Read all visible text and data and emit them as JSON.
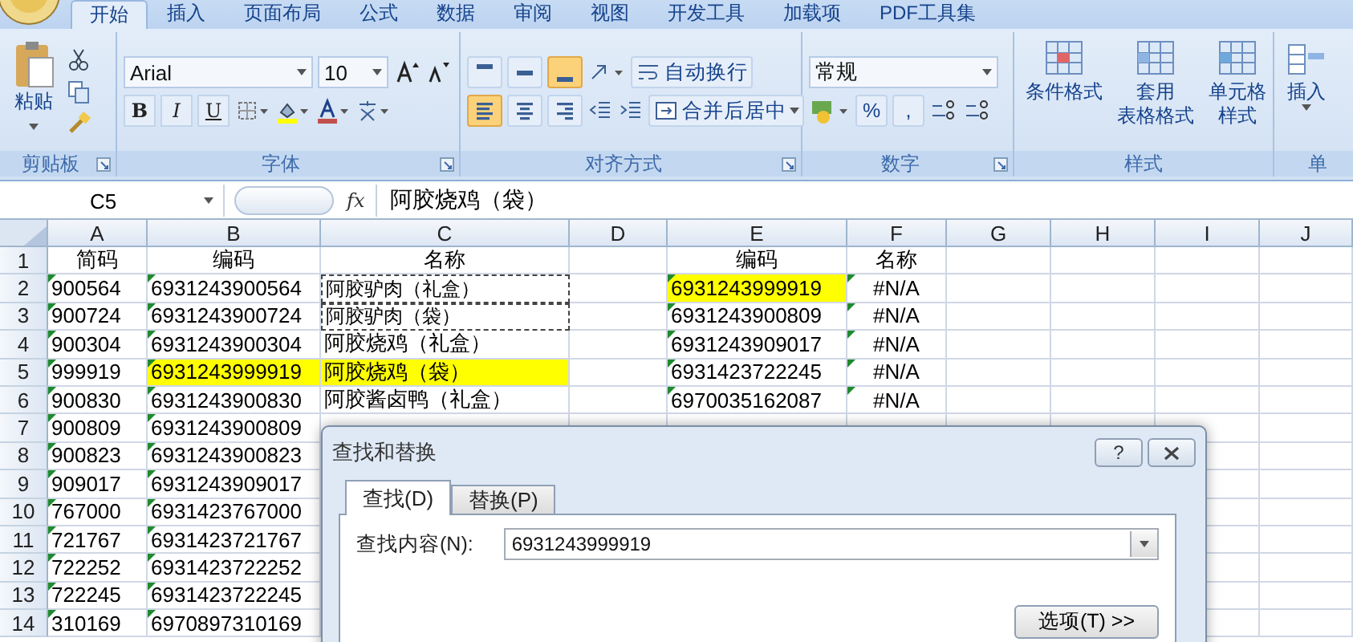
{
  "tabs": [
    {
      "label": "开始",
      "selected": true
    },
    {
      "label": "插入",
      "selected": false
    },
    {
      "label": "页面布局",
      "selected": false
    },
    {
      "label": "公式",
      "selected": false
    },
    {
      "label": "数据",
      "selected": false
    },
    {
      "label": "审阅",
      "selected": false
    },
    {
      "label": "视图",
      "selected": false
    },
    {
      "label": "开发工具",
      "selected": false
    },
    {
      "label": "加载项",
      "selected": false
    },
    {
      "label": "PDF工具集",
      "selected": false
    }
  ],
  "ribbon": {
    "clipboard": {
      "label": "剪贴板",
      "paste": "粘贴"
    },
    "font": {
      "label": "字体",
      "font_name": "Arial",
      "font_size": "10",
      "format_keys": [
        "B",
        "I",
        "U"
      ]
    },
    "alignment": {
      "label": "对齐方式",
      "vertical_buttons": [
        {
          "selected": false
        },
        {
          "selected": false
        },
        {
          "selected": true
        }
      ],
      "horizontal_buttons": [
        {
          "selected": true
        },
        {
          "selected": false
        },
        {
          "selected": false
        }
      ],
      "wrap": "自动换行",
      "merge": "合并后居中"
    },
    "number": {
      "label": "数字",
      "format": "常规",
      "percent": "%",
      "comma": ","
    },
    "styles": {
      "label": "样式",
      "buttons": [
        {
          "lines": [
            "条件格式"
          ]
        },
        {
          "lines": [
            "套用",
            "表格格式"
          ]
        },
        {
          "lines": [
            "单元格",
            "样式"
          ]
        }
      ]
    },
    "cells": {
      "label": "单",
      "insert": "插入"
    }
  },
  "formula_bar": {
    "name_box": "C5",
    "function_label": "fx",
    "content": "阿胶烧鸡（袋）"
  },
  "sheet": {
    "columns": [
      "A",
      "B",
      "C",
      "D",
      "E",
      "F",
      "G",
      "H",
      "I",
      "J"
    ],
    "rows": [
      {
        "number": "1",
        "cells": [
          {
            "text": "简码",
            "kind": "header",
            "flagged": false,
            "highlighted": false,
            "marquee": false
          },
          {
            "text": "编码",
            "kind": "header",
            "flagged": false,
            "highlighted": false,
            "marquee": false
          },
          {
            "text": "名称",
            "kind": "header",
            "flagged": false,
            "highlighted": false,
            "marquee": false
          },
          null,
          {
            "text": "编码",
            "kind": "header",
            "flagged": false,
            "highlighted": false,
            "marquee": false
          },
          {
            "text": "名称",
            "kind": "header",
            "flagged": false,
            "highlighted": false,
            "marquee": false
          },
          null,
          null,
          null,
          null
        ]
      },
      {
        "number": "2",
        "cells": [
          {
            "text": "900564",
            "kind": "text",
            "flagged": true,
            "highlighted": false,
            "marquee": false
          },
          {
            "text": "6931243900564",
            "kind": "text",
            "flagged": true,
            "highlighted": false,
            "marquee": false
          },
          {
            "text": "阿胶驴肉（礼盒）",
            "kind": "text",
            "flagged": false,
            "highlighted": false,
            "marquee": true
          },
          null,
          {
            "text": "6931243999919",
            "kind": "text",
            "flagged": true,
            "highlighted": true,
            "marquee": false
          },
          {
            "text": "#N/A",
            "kind": "error",
            "flagged": true,
            "highlighted": false,
            "marquee": false
          },
          null,
          null,
          null,
          null
        ]
      },
      {
        "number": "3",
        "cells": [
          {
            "text": "900724",
            "kind": "text",
            "flagged": true,
            "highlighted": false,
            "marquee": false
          },
          {
            "text": "6931243900724",
            "kind": "text",
            "flagged": true,
            "highlighted": false,
            "marquee": false
          },
          {
            "text": "阿胶驴肉（袋）",
            "kind": "text",
            "flagged": false,
            "highlighted": false,
            "marquee": true
          },
          null,
          {
            "text": "6931243900809",
            "kind": "text",
            "flagged": true,
            "highlighted": false,
            "marquee": false
          },
          {
            "text": "#N/A",
            "kind": "error",
            "flagged": true,
            "highlighted": false,
            "marquee": false
          },
          null,
          null,
          null,
          null
        ]
      },
      {
        "number": "4",
        "cells": [
          {
            "text": "900304",
            "kind": "text",
            "flagged": true,
            "highlighted": false,
            "marquee": false
          },
          {
            "text": "6931243900304",
            "kind": "text",
            "flagged": true,
            "highlighted": false,
            "marquee": false
          },
          {
            "text": "阿胶烧鸡（礼盒）",
            "kind": "text",
            "flagged": false,
            "highlighted": false,
            "marquee": false
          },
          null,
          {
            "text": "6931243909017",
            "kind": "text",
            "flagged": true,
            "highlighted": false,
            "marquee": false
          },
          {
            "text": "#N/A",
            "kind": "error",
            "flagged": true,
            "highlighted": false,
            "marquee": false
          },
          null,
          null,
          null,
          null
        ]
      },
      {
        "number": "5",
        "cells": [
          {
            "text": "999919",
            "kind": "text",
            "flagged": true,
            "highlighted": false,
            "marquee": false
          },
          {
            "text": "6931243999919",
            "kind": "text",
            "flagged": true,
            "highlighted": true,
            "marquee": false
          },
          {
            "text": "阿胶烧鸡（袋）",
            "kind": "text",
            "flagged": false,
            "highlighted": true,
            "marquee": false
          },
          null,
          {
            "text": "6931423722245",
            "kind": "text",
            "flagged": true,
            "highlighted": false,
            "marquee": false
          },
          {
            "text": "#N/A",
            "kind": "error",
            "flagged": true,
            "highlighted": false,
            "marquee": false
          },
          null,
          null,
          null,
          null
        ]
      },
      {
        "number": "6",
        "cells": [
          {
            "text": "900830",
            "kind": "text",
            "flagged": true,
            "highlighted": false,
            "marquee": false
          },
          {
            "text": "6931243900830",
            "kind": "text",
            "flagged": true,
            "highlighted": false,
            "marquee": false
          },
          {
            "text": "阿胶酱卤鸭（礼盒）",
            "kind": "text",
            "flagged": false,
            "highlighted": false,
            "marquee": false
          },
          null,
          {
            "text": "6970035162087",
            "kind": "text",
            "flagged": true,
            "highlighted": false,
            "marquee": false
          },
          {
            "text": "#N/A",
            "kind": "error",
            "flagged": true,
            "highlighted": false,
            "marquee": false
          },
          null,
          null,
          null,
          null
        ]
      },
      {
        "number": "7",
        "cells": [
          {
            "text": "900809",
            "kind": "text",
            "flagged": true,
            "highlighted": false,
            "marquee": false
          },
          {
            "text": "6931243900809",
            "kind": "text",
            "flagged": true,
            "highlighted": false,
            "marquee": false
          },
          null,
          null,
          null,
          null,
          null,
          null,
          null,
          null
        ]
      },
      {
        "number": "8",
        "cells": [
          {
            "text": "900823",
            "kind": "text",
            "flagged": true,
            "highlighted": false,
            "marquee": false
          },
          {
            "text": "6931243900823",
            "kind": "text",
            "flagged": true,
            "highlighted": false,
            "marquee": false
          },
          null,
          null,
          null,
          null,
          null,
          null,
          null,
          null
        ]
      },
      {
        "number": "9",
        "cells": [
          {
            "text": "909017",
            "kind": "text",
            "flagged": true,
            "highlighted": false,
            "marquee": false
          },
          {
            "text": "6931243909017",
            "kind": "text",
            "flagged": true,
            "highlighted": false,
            "marquee": false
          },
          null,
          null,
          null,
          null,
          null,
          null,
          null,
          null
        ]
      },
      {
        "number": "10",
        "cells": [
          {
            "text": "767000",
            "kind": "text",
            "flagged": true,
            "highlighted": false,
            "marquee": false
          },
          {
            "text": "6931423767000",
            "kind": "text",
            "flagged": true,
            "highlighted": false,
            "marquee": false
          },
          null,
          null,
          null,
          null,
          null,
          null,
          null,
          null
        ]
      },
      {
        "number": "11",
        "cells": [
          {
            "text": "721767",
            "kind": "text",
            "flagged": true,
            "highlighted": false,
            "marquee": false
          },
          {
            "text": "6931423721767",
            "kind": "text",
            "flagged": true,
            "highlighted": false,
            "marquee": false
          },
          null,
          null,
          null,
          null,
          null,
          null,
          null,
          null
        ]
      },
      {
        "number": "12",
        "cells": [
          {
            "text": "722252",
            "kind": "text",
            "flagged": true,
            "highlighted": false,
            "marquee": false
          },
          {
            "text": "6931423722252",
            "kind": "text",
            "flagged": true,
            "highlighted": false,
            "marquee": false
          },
          null,
          null,
          null,
          null,
          null,
          null,
          null,
          null
        ]
      },
      {
        "number": "13",
        "cells": [
          {
            "text": "722245",
            "kind": "text",
            "flagged": true,
            "highlighted": false,
            "marquee": false
          },
          {
            "text": "6931423722245",
            "kind": "text",
            "flagged": true,
            "highlighted": false,
            "marquee": false
          },
          null,
          null,
          null,
          null,
          null,
          null,
          null,
          null
        ]
      },
      {
        "number": "14",
        "cells": [
          {
            "text": "310169",
            "kind": "text",
            "flagged": true,
            "highlighted": false,
            "marquee": false
          },
          {
            "text": "6970897310169",
            "kind": "text",
            "flagged": true,
            "highlighted": false,
            "marquee": false
          },
          null,
          null,
          null,
          null,
          null,
          null,
          null,
          null
        ]
      }
    ]
  },
  "dialog": {
    "title": "查找和替换",
    "help": "?",
    "tabs": [
      {
        "label": "查找(D)",
        "selected": true
      },
      {
        "label": "替换(P)",
        "selected": false
      }
    ],
    "field_label": "查找内容(N):",
    "field_value": "6931243999919",
    "options_button": "选项(T) >>"
  }
}
